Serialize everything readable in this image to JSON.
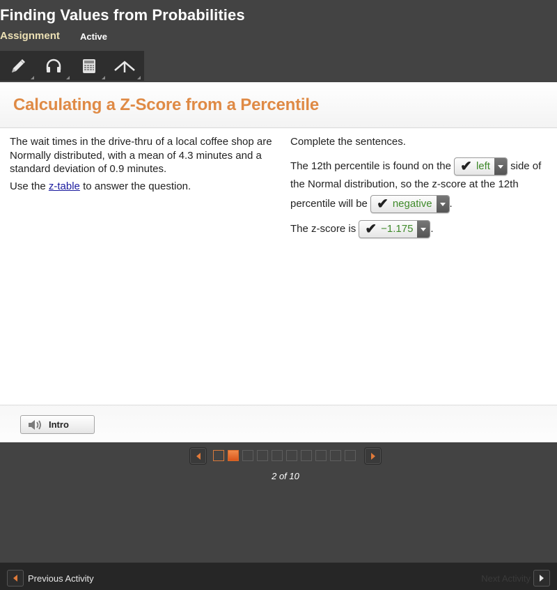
{
  "header": {
    "title": "Finding Values from Probabilities",
    "assignment_label": "Assignment",
    "status": "Active",
    "tools": [
      {
        "name": "pencil-icon",
        "label": "Pencil"
      },
      {
        "name": "headphones-icon",
        "label": "Audio"
      },
      {
        "name": "calculator-icon",
        "label": "Calculator"
      },
      {
        "name": "reference-icon",
        "label": "Reference"
      }
    ]
  },
  "lesson": {
    "title": "Calculating a Z-Score from a Percentile",
    "problem": {
      "paragraph1": "The wait times in the drive-thru of a local coffee shop are Normally distributed, with a mean of 4.3 minutes and a standard deviation of 0.9 minutes.",
      "use_prefix": "Use the ",
      "link_text": "z-table",
      "use_suffix": " to answer the question."
    },
    "instructions": "Complete the sentences.",
    "sentence1": {
      "before": "The 12th percentile is found on the ",
      "dropdown_value": "left",
      "after": " side of"
    },
    "sentence1_line2": "the Normal distribution, so the z-score at the 12th",
    "sentence1_line3": {
      "before": "percentile will be ",
      "dropdown_value": "negative",
      "after": "."
    },
    "sentence2": {
      "before": "The z-score is ",
      "dropdown_value": "−1.175",
      "after": "."
    },
    "check_mark": "✔",
    "answer_color": "#3f8a2a"
  },
  "intro_button": {
    "label": "Intro"
  },
  "pager": {
    "current": 2,
    "total": 10,
    "label": "2 of 10",
    "pages": [
      {
        "state": "visited"
      },
      {
        "state": "current"
      },
      {
        "state": "unvisited"
      },
      {
        "state": "unvisited"
      },
      {
        "state": "unvisited"
      },
      {
        "state": "unvisited"
      },
      {
        "state": "unvisited"
      },
      {
        "state": "unvisited"
      },
      {
        "state": "unvisited"
      },
      {
        "state": "unvisited"
      }
    ]
  },
  "bottom_nav": {
    "previous_label": "Previous Activity",
    "next_label": "Next Activity"
  },
  "colors": {
    "accent_orange": "#df8a45",
    "assignment_text": "#ece0b4",
    "dark_bg": "#434343",
    "link": "#1a1a9e"
  }
}
